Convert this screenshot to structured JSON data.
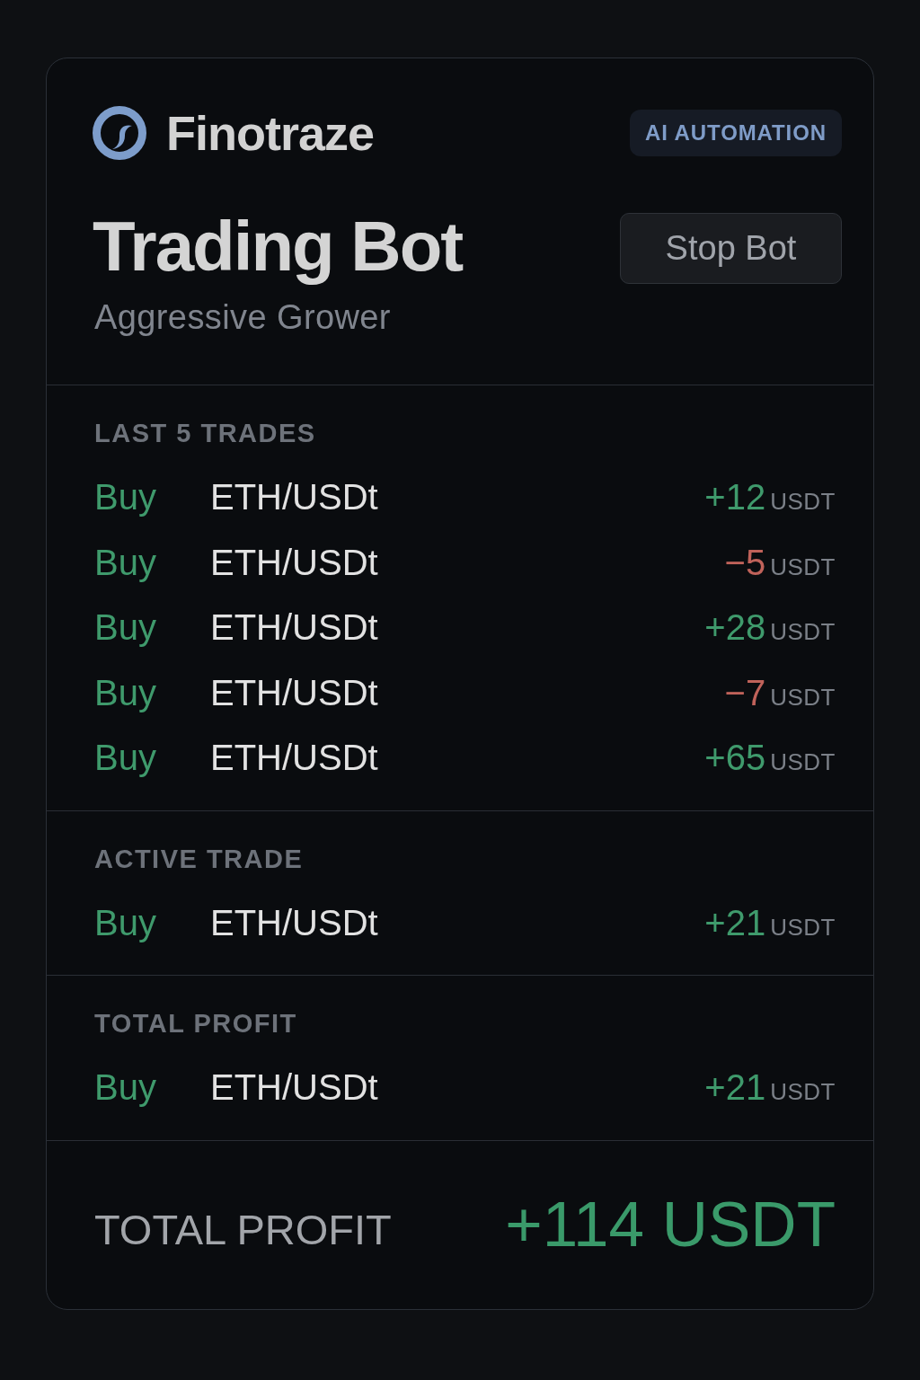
{
  "brand": {
    "name": "Finotraze",
    "badge": "AI AUTOMATION"
  },
  "bot": {
    "title": "Trading Bot",
    "strategy": "Aggressive Grower",
    "action": "Stop Bot"
  },
  "sections": [
    {
      "heading": "LAST 5 TRADES",
      "trades": [
        {
          "side": "Buy",
          "pair": "ETH/USDt",
          "amount": "+12",
          "unit": "USDT",
          "kind": "gain"
        },
        {
          "side": "Buy",
          "pair": "ETH/USDt",
          "amount": "−5",
          "unit": "USDT",
          "kind": "loss"
        },
        {
          "side": "Buy",
          "pair": "ETH/USDt",
          "amount": "+28",
          "unit": "USDT",
          "kind": "gain"
        },
        {
          "side": "Buy",
          "pair": "ETH/USDt",
          "amount": "−7",
          "unit": "USDT",
          "kind": "loss"
        },
        {
          "side": "Buy",
          "pair": "ETH/USDt",
          "amount": "+65",
          "unit": "USDT",
          "kind": "gain"
        }
      ]
    },
    {
      "heading": "ACTIVE TRADE",
      "trades": [
        {
          "side": "Buy",
          "pair": "ETH/USDt",
          "amount": "+21",
          "unit": "USDT",
          "kind": "gain"
        }
      ]
    },
    {
      "heading": "TOTAL PROFIT",
      "trades": [
        {
          "side": "Buy",
          "pair": "ETH/USDt",
          "amount": "+21",
          "unit": "USDT",
          "kind": "gain"
        }
      ]
    }
  ],
  "summary": {
    "label": "TOTAL PROFIT",
    "value": "+114 USDT"
  }
}
